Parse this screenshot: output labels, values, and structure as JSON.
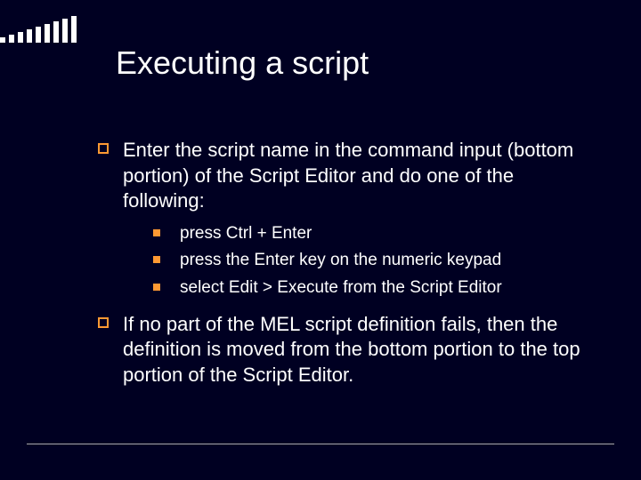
{
  "title": "Executing a script",
  "items": [
    {
      "text": "Enter the script name in the command input (bottom portion) of the Script Editor and do one of the following:",
      "sub": [
        "press Ctrl + Enter",
        "press the Enter key on the numeric keypad",
        "select Edit > Execute from the Script Editor"
      ]
    },
    {
      "text": "If no part of the MEL script definition fails, then the definition is moved from the bottom portion to the top portion of the Script Editor.",
      "sub": []
    }
  ]
}
